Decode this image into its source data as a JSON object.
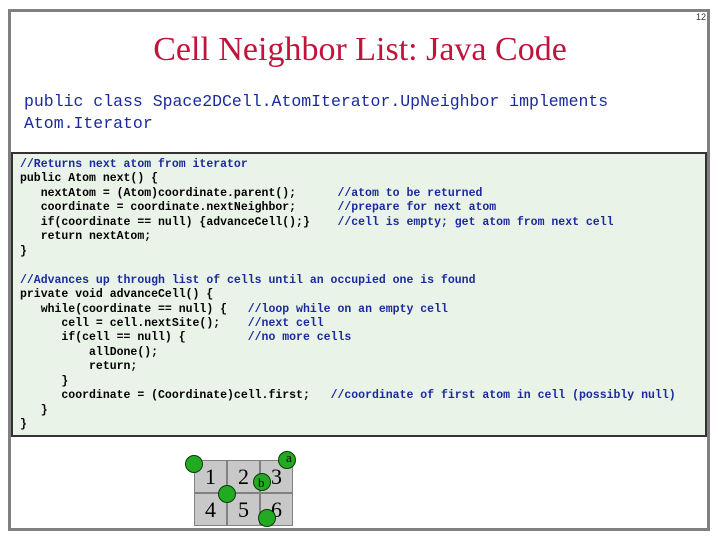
{
  "page_number": "12",
  "title": "Cell Neighbor List: Java Code",
  "subtitle": "public class Space2DCell.AtomIterator.UpNeighbor implements Atom.Iterator",
  "code_lines": [
    {
      "code": "//Returns next atom from iterator",
      "comment": ""
    },
    {
      "code": "public Atom next() {",
      "comment": ""
    },
    {
      "code": "   nextAtom = (Atom)coordinate.parent();      ",
      "comment": "//atom to be returned"
    },
    {
      "code": "   coordinate = coordinate.nextNeighbor;      ",
      "comment": "//prepare for next atom"
    },
    {
      "code": "   if(coordinate == null) {advanceCell();}    ",
      "comment": "//cell is empty; get atom from next cell"
    },
    {
      "code": "   return nextAtom;",
      "comment": ""
    },
    {
      "code": "}",
      "comment": ""
    },
    {
      "code": "",
      "comment": ""
    },
    {
      "code": "//Advances up through list of cells until an occupied one is found",
      "comment": ""
    },
    {
      "code": "private void advanceCell() {",
      "comment": ""
    },
    {
      "code": "   while(coordinate == null) {   ",
      "comment": "//loop while on an empty cell"
    },
    {
      "code": "      cell = cell.nextSite();    ",
      "comment": "//next cell"
    },
    {
      "code": "      if(cell == null) {         ",
      "comment": "//no more cells"
    },
    {
      "code": "          allDone();",
      "comment": ""
    },
    {
      "code": "          return;",
      "comment": ""
    },
    {
      "code": "      }",
      "comment": ""
    },
    {
      "code": "      coordinate = (Coordinate)cell.first;   ",
      "comment": "//coordinate of first atom in cell (possibly null)"
    },
    {
      "code": "   }",
      "comment": ""
    },
    {
      "code": "}",
      "comment": ""
    }
  ],
  "diagram": {
    "cells": [
      "1",
      "2",
      "3",
      "4",
      "5",
      "6"
    ],
    "atom_labels": [
      "a",
      "b"
    ]
  }
}
